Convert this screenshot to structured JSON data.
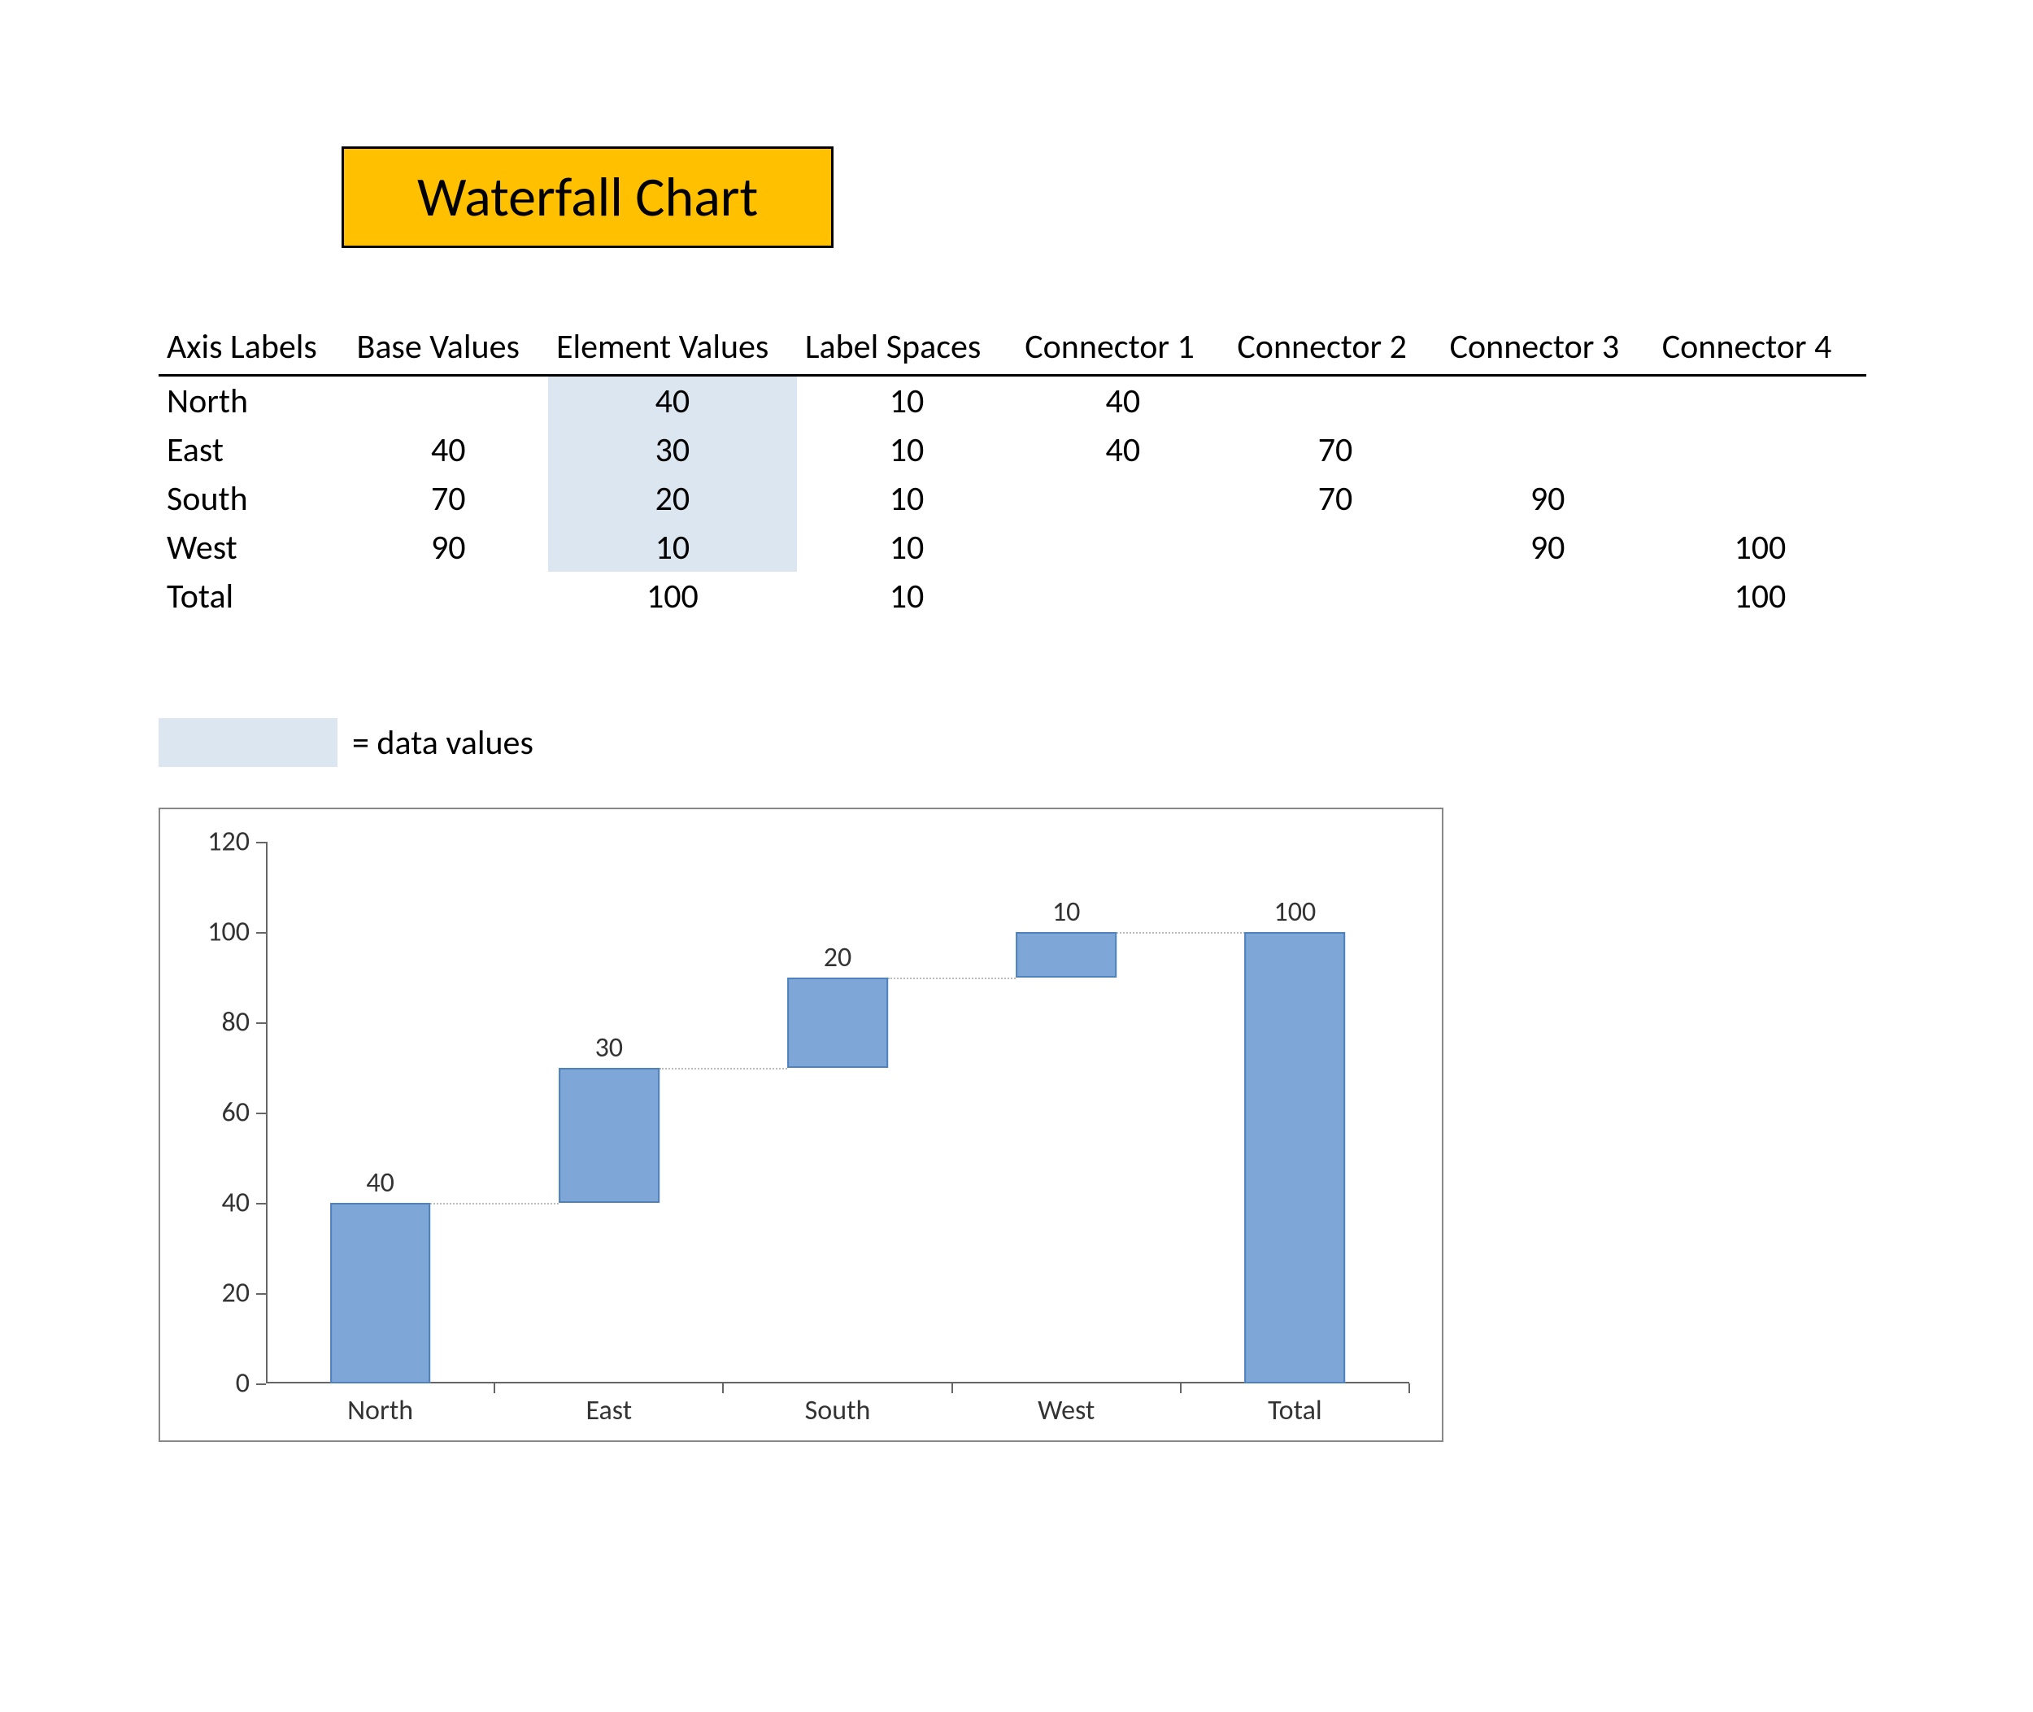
{
  "title": "Waterfall Chart",
  "legend_label": "= data values",
  "table": {
    "headers": [
      "Axis Labels",
      "Base Values",
      "Element Values",
      "Label Spaces",
      "Connector 1",
      "Connector 2",
      "Connector 3",
      "Connector 4"
    ],
    "rows": [
      {
        "axis": "North",
        "base": "",
        "elem": "40",
        "space": "10",
        "c1": "40",
        "c2": "",
        "c3": "",
        "c4": "",
        "hl": true
      },
      {
        "axis": "East",
        "base": "40",
        "elem": "30",
        "space": "10",
        "c1": "40",
        "c2": "70",
        "c3": "",
        "c4": "",
        "hl": true
      },
      {
        "axis": "South",
        "base": "70",
        "elem": "20",
        "space": "10",
        "c1": "",
        "c2": "70",
        "c3": "90",
        "c4": "",
        "hl": true
      },
      {
        "axis": "West",
        "base": "90",
        "elem": "10",
        "space": "10",
        "c1": "",
        "c2": "",
        "c3": "90",
        "c4": "100",
        "hl": true
      },
      {
        "axis": "Total",
        "base": "",
        "elem": "100",
        "space": "10",
        "c1": "",
        "c2": "",
        "c3": "",
        "c4": "100",
        "hl": false
      }
    ]
  },
  "chart_data": {
    "type": "bar",
    "title": "",
    "xlabel": "",
    "ylabel": "",
    "ylim": [
      0,
      120
    ],
    "y_ticks": [
      0,
      20,
      40,
      60,
      80,
      100,
      120
    ],
    "categories": [
      "North",
      "East",
      "South",
      "West",
      "Total"
    ],
    "series": [
      {
        "name": "Base",
        "values": [
          0,
          40,
          70,
          90,
          0
        ],
        "visible": false
      },
      {
        "name": "Element",
        "values": [
          40,
          30,
          20,
          10,
          100
        ],
        "visible": true
      }
    ],
    "data_labels": [
      40,
      30,
      20,
      10,
      100
    ]
  },
  "colors": {
    "title_bg": "#FFC000",
    "highlight": "#DCE6F1",
    "bar_fill": "#7EA6D7",
    "bar_border": "#4F81BD"
  }
}
